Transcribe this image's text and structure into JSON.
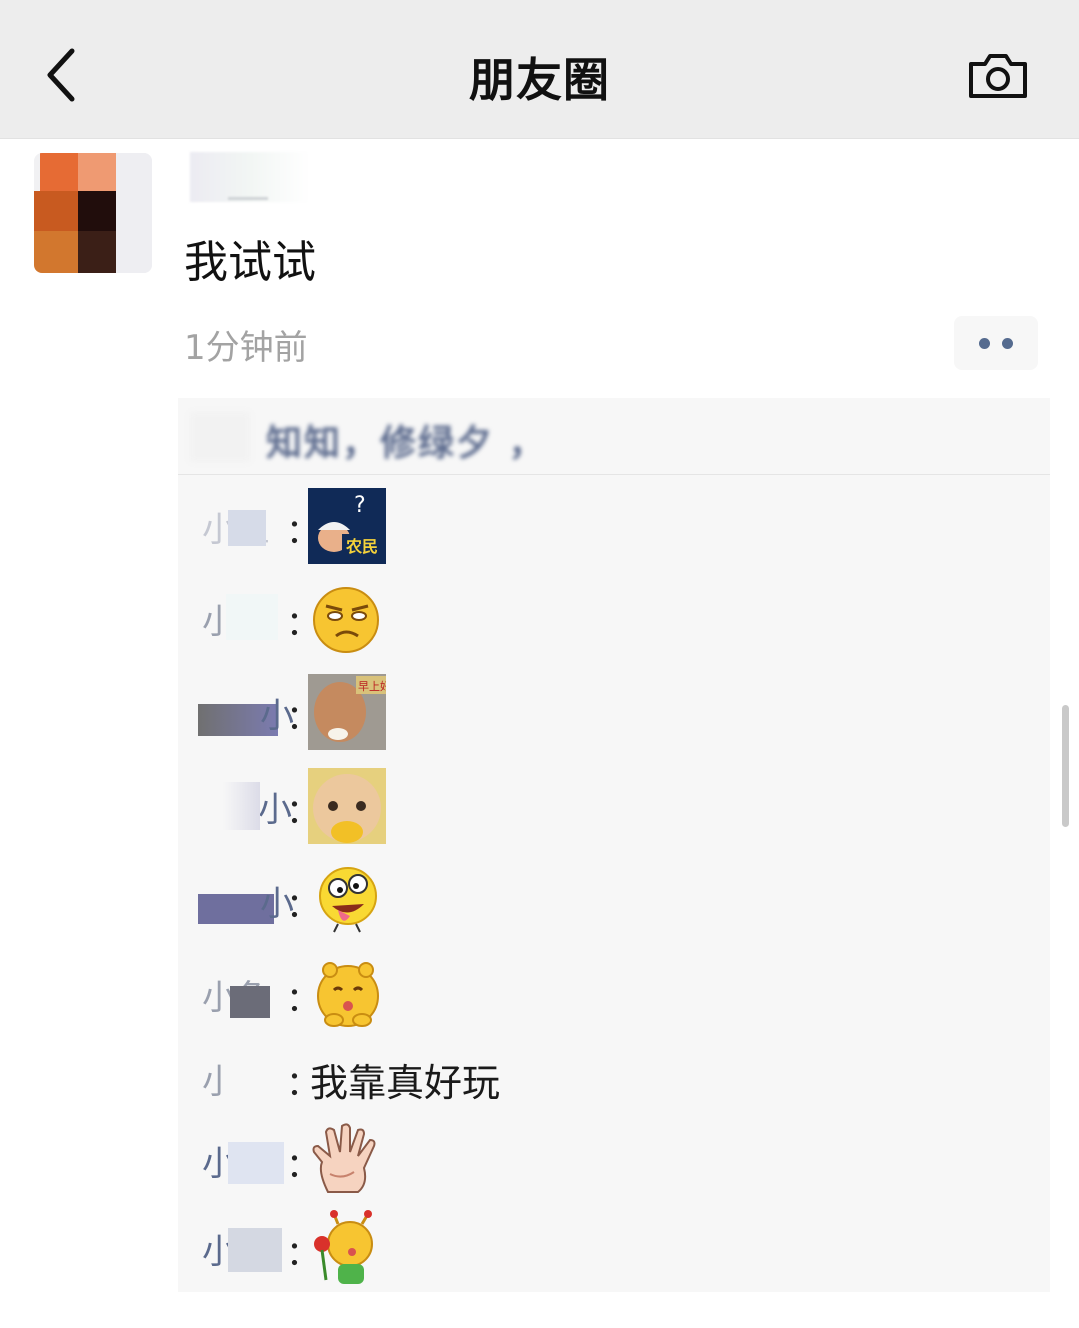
{
  "header": {
    "title": "朋友圈"
  },
  "post": {
    "text": "我试试",
    "time": "1分钟前"
  },
  "likes": {
    "names": "知知，修绿夕 ，"
  },
  "comments": [
    {
      "name": "小鱼",
      "colon": "：",
      "sticker": "farmer-meme-sticker"
    },
    {
      "name": "小鱼",
      "colon": "：",
      "sticker": "smirk-emoji-sticker"
    },
    {
      "name": "小鱼",
      "colon": "：",
      "sticker": "bald-man-meme-sticker"
    },
    {
      "name": "小鱼",
      "colon": "：",
      "sticker": "baby-face-sticker"
    },
    {
      "name": "小鱼",
      "colon": "：",
      "sticker": "crazy-tongue-emoji-sticker"
    },
    {
      "name": "小鱼",
      "colon": "：",
      "sticker": "kiss-hug-emoji-sticker"
    },
    {
      "name": "小鱼",
      "colon": "：",
      "text": "我靠真好玩"
    },
    {
      "name": "小鱼",
      "colon": "：",
      "sticker": "waving-hand-sticker"
    },
    {
      "name": "小鱼",
      "colon": "：",
      "sticker": "rose-kiss-emoji-sticker"
    }
  ],
  "icons": {
    "back": "chevron-left-icon",
    "camera": "camera-icon",
    "more": "more-dots-icon"
  },
  "colors": {
    "navbar_bg": "#ededed",
    "name_blue": "#5b6a8d",
    "panel_bg": "#f7f7f7",
    "time_gray": "#a3a3a3"
  }
}
